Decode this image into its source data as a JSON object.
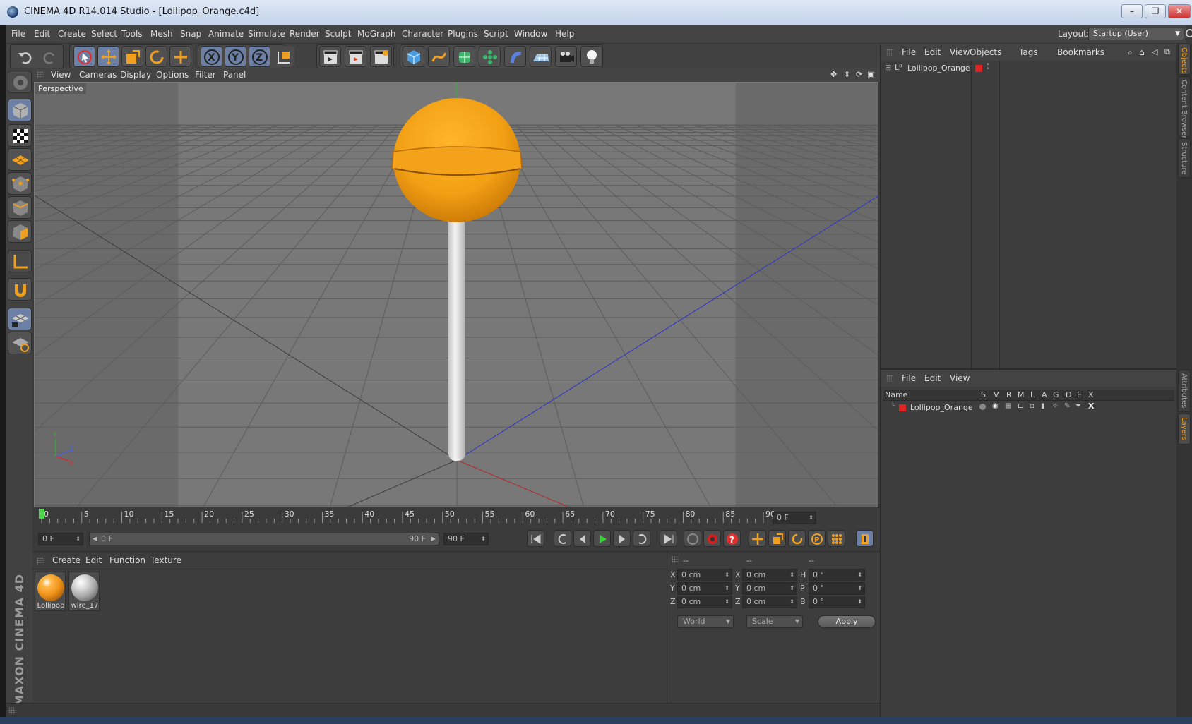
{
  "window": {
    "title": "CINEMA 4D R14.014 Studio - [Lollipop_Orange.c4d]",
    "minimize": "–",
    "restore": "❐",
    "close": "✕"
  },
  "menubar": {
    "items": [
      "File",
      "Edit",
      "Create",
      "Select",
      "Tools",
      "Mesh",
      "Snap",
      "Animate",
      "Simulate",
      "Render",
      "Sculpt",
      "MoGraph",
      "Character",
      "Plugins",
      "Script",
      "Window",
      "Help"
    ],
    "layout_label": "Layout:",
    "layout_value": "Startup (User)"
  },
  "viewport": {
    "menu": [
      "View",
      "Cameras",
      "Display",
      "Options",
      "Filter",
      "Panel"
    ],
    "label": "Perspective",
    "axis": {
      "y": "Y",
      "z": "Z",
      "x": "X"
    }
  },
  "timeline": {
    "ticks": [
      "0",
      "5",
      "10",
      "15",
      "20",
      "25",
      "30",
      "35",
      "40",
      "45",
      "50",
      "55",
      "60",
      "65",
      "70",
      "75",
      "80",
      "85",
      "90"
    ],
    "current_frame_right": "0 F",
    "start_field": "0 F",
    "range_start": "0 F",
    "range_end": "90 F",
    "end_field": "90 F",
    "playhead_frame": 0
  },
  "material_manager": {
    "menu": [
      "Create",
      "Edit",
      "Function",
      "Texture"
    ],
    "materials": [
      {
        "name": "Lollipop",
        "color": "#f0921a"
      },
      {
        "name": "wire_17",
        "color": "#bdbdbd"
      }
    ]
  },
  "coordinates": {
    "headers": [
      "--",
      "--",
      "--"
    ],
    "rows": [
      {
        "axis": "X",
        "pos": "0 cm",
        "axis2": "X",
        "size": "0 cm",
        "rot_label": "H",
        "rot": "0 °"
      },
      {
        "axis": "Y",
        "pos": "0 cm",
        "axis2": "Y",
        "size": "0 cm",
        "rot_label": "P",
        "rot": "0 °"
      },
      {
        "axis": "Z",
        "pos": "0 cm",
        "axis2": "Z",
        "size": "0 cm",
        "rot_label": "B",
        "rot": "0 °"
      }
    ],
    "mode_world": "World",
    "mode_scale": "Scale",
    "apply": "Apply"
  },
  "object_manager": {
    "menu": [
      "File",
      "Edit",
      "View",
      "Objects",
      "Tags",
      "Bookmarks"
    ],
    "objects": [
      {
        "name": "Lollipop_Orange",
        "layer_color": "#e02424"
      }
    ]
  },
  "layer_manager": {
    "menu": [
      "File",
      "Edit",
      "View"
    ],
    "columns": [
      "Name",
      "S",
      "V",
      "R",
      "M",
      "L",
      "A",
      "G",
      "D",
      "E",
      "X"
    ],
    "layers": [
      {
        "name": "Lollipop_Orange",
        "color": "#e02424"
      }
    ]
  },
  "right_tabs": [
    "Objects",
    "Content Browser",
    "Structure",
    "Attributes",
    "Layers"
  ],
  "brand": "MAXON CINEMA 4D",
  "accent_colors": {
    "orange": "#f0a020",
    "selected": "#6c7fa5"
  }
}
